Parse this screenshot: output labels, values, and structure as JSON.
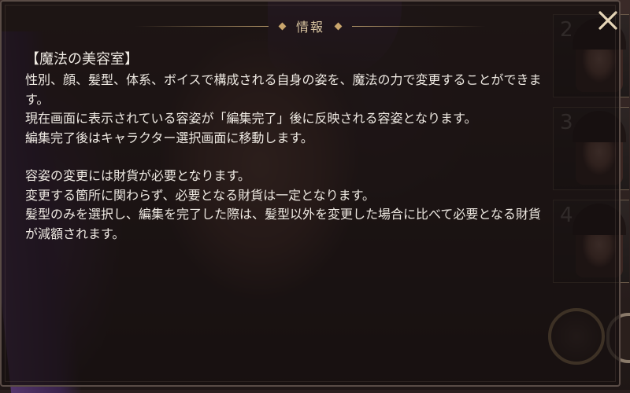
{
  "dialog": {
    "title": "情報",
    "close_icon": "close-x-icon",
    "heading": "【魔法の美容室】",
    "paragraph1": [
      "性別、顔、髪型、体系、ボイスで構成される自身の姿を、魔法の力で変更することができま",
      "す。",
      "現在画面に表示されている容姿が「編集完了」後に反映される容姿となります。",
      "編集完了後はキャラクター選択画面に移動します。"
    ],
    "paragraph2": [
      "容姿の変更には財貨が必要となります。",
      "変更する箇所に関わらず、必要となる財貨は一定となります。",
      "髪型のみを選択し、編集を完了した際は、髪型以外を変更した場合に比べて必要となる財貨",
      "が減額されます。"
    ]
  },
  "slots": [
    {
      "number": "2"
    },
    {
      "number": "3"
    },
    {
      "number": "4"
    }
  ],
  "colors": {
    "accent_gold": "#c9a56c",
    "text": "#eee9e2",
    "panel_bg": "rgba(22,16,16,0.78)"
  }
}
